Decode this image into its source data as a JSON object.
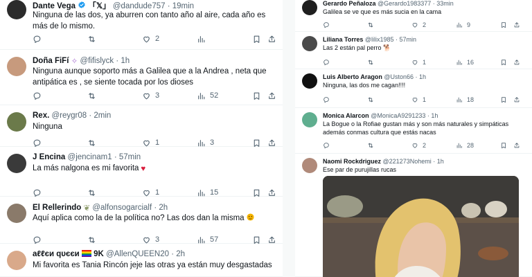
{
  "left_tweets": [
    {
      "name": "Dante Vega",
      "name_suffix": "「𝕏」",
      "handle": "@dandude757",
      "time": "· 19min",
      "text": "Ninguna de las dos, ya aburren con tanto año al aire, cada año es más de lo mismo.",
      "replies": "",
      "retweets": "",
      "likes": "2",
      "views": "",
      "avatar_color": "#2b2b2b"
    },
    {
      "name": "Doña FiFí",
      "name_suffix": "",
      "handle": "@fifislyck",
      "time": "· 1h",
      "text": "Ninguna aunque soporto más a Galilea que a la Andrea , neta que antipática es , se siente tocada por los dioses",
      "replies": "",
      "retweets": "",
      "likes": "3",
      "views": "52",
      "avatar_color": "#c79a7d"
    },
    {
      "name": "Rex.",
      "name_suffix": "",
      "handle": "@reygr08",
      "time": "· 2min",
      "text": "Ninguna",
      "replies": "",
      "retweets": "",
      "likes": "1",
      "views": "3",
      "avatar_color": "#6b7a4a"
    },
    {
      "name": "J Encina",
      "name_suffix": "",
      "handle": "@jencinam1",
      "time": "· 57min",
      "text": "La más nalgona es mi favorita",
      "replies": "",
      "retweets": "",
      "likes": "1",
      "views": "15",
      "avatar_color": "#3a3a3a"
    },
    {
      "name": "El Rellerindo",
      "name_suffix": "",
      "handle": "@alfonsogarcialf",
      "time": "· 2h",
      "text": "Aquí aplica como la de la política no? Las dos dan la misma",
      "replies": "",
      "retweets": "",
      "likes": "3",
      "views": "57",
      "avatar_color": "#8a7a6a"
    },
    {
      "name": "aℓℓєи qυєєи",
      "name_suffix": "9K",
      "handle": "@AllenQUEEN20",
      "time": "· 2h",
      "text": "Mi favorita es Tania Rincón jeje las otras ya están muy desgastadas",
      "replies": "",
      "retweets": "",
      "likes": "",
      "views": "",
      "avatar_color": "#d9a98a"
    }
  ],
  "right_tweets": [
    {
      "name": "Gerardo Peñaloza",
      "handle": "@Gerardo1983377",
      "time": "· 33min",
      "text": "Galilea se ve que es más sucia en la cama",
      "replies": "",
      "retweets": "",
      "likes": "2",
      "views": "9",
      "avatar_color": "#1f1f1f"
    },
    {
      "name": "Liliana Torres",
      "handle": "@lilix1985",
      "time": "· 57min",
      "text": "Las 2 están pal perro 🐕",
      "replies": "",
      "retweets": "",
      "likes": "1",
      "views": "16",
      "avatar_color": "#4a4a4a"
    },
    {
      "name": "Luis Alberto Aragon",
      "handle": "@Uston66",
      "time": "· 1h",
      "text": "Ninguna, las dos me cagan!!!!",
      "replies": "",
      "retweets": "",
      "likes": "1",
      "views": "18",
      "avatar_color": "#111111"
    },
    {
      "name": "Monica Alarcon",
      "handle": "@MonicaA9291233",
      "time": "· 1h",
      "text": "La Bogue o la Rofiae gustan más y son más naturales y simpáticas además conmas cultura que estás nacas",
      "replies": "",
      "retweets": "",
      "likes": "2",
      "views": "28",
      "avatar_color": "#5fae8f"
    },
    {
      "name": "Naomi Rockdriguez",
      "handle": "@221273Nohemi",
      "time": "· 1h",
      "text": "Ese par de purujillas rucas",
      "replies": "",
      "retweets": "",
      "likes": "",
      "views": "",
      "avatar_color": "#b08a7a"
    }
  ],
  "colors": {
    "text": "#0f1419",
    "muted": "#536471",
    "verified_blue": "#1d9bf0",
    "divider": "#eff3f4",
    "heart": "#e0245e"
  },
  "icons": [
    "reply-icon",
    "retweet-icon",
    "like-icon",
    "views-icon",
    "bookmark-icon",
    "share-icon",
    "verified-icon"
  ]
}
